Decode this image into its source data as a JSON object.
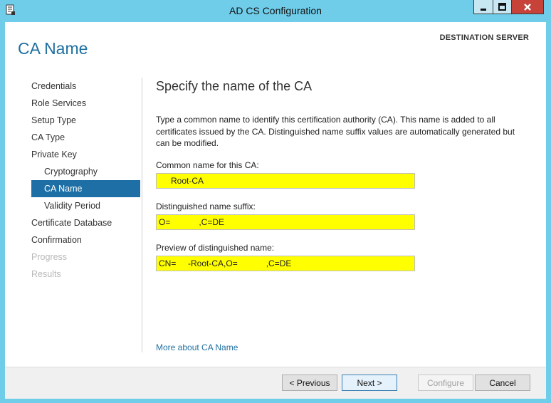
{
  "window": {
    "title": "AD CS Configuration",
    "controls": {
      "minimize": "_",
      "maximize": "□",
      "close": "×"
    }
  },
  "page": {
    "title": "CA Name",
    "destination_label": "DESTINATION SERVER"
  },
  "nav": {
    "items": [
      {
        "label": "Credentials",
        "state": "normal",
        "level": 0
      },
      {
        "label": "Role Services",
        "state": "normal",
        "level": 0
      },
      {
        "label": "Setup Type",
        "state": "normal",
        "level": 0
      },
      {
        "label": "CA Type",
        "state": "normal",
        "level": 0
      },
      {
        "label": "Private Key",
        "state": "normal",
        "level": 0
      },
      {
        "label": "Cryptography",
        "state": "normal",
        "level": 1
      },
      {
        "label": "CA Name",
        "state": "active",
        "level": 1
      },
      {
        "label": "Validity Period",
        "state": "normal",
        "level": 1
      },
      {
        "label": "Certificate Database",
        "state": "normal",
        "level": 0
      },
      {
        "label": "Confirmation",
        "state": "normal",
        "level": 0
      },
      {
        "label": "Progress",
        "state": "disabled",
        "level": 0
      },
      {
        "label": "Results",
        "state": "disabled",
        "level": 0
      }
    ]
  },
  "main": {
    "heading": "Specify the name of the CA",
    "description": "Type a common name to identify this certification authority (CA). This name is added to all certificates issued by the CA. Distinguished name suffix values are automatically generated but can be modified.",
    "common_name_label": "Common name for this CA:",
    "common_name_value": "Root-CA",
    "suffix_label": "Distinguished name suffix:",
    "suffix_value": "O=            ,C=DE",
    "preview_label": "Preview of distinguished name:",
    "preview_value": "CN=     -Root-CA,O=            ,C=DE",
    "more_link": "More about CA Name",
    "highlight_color": "#ffff00"
  },
  "footer": {
    "previous": "< Previous",
    "next": "Next >",
    "configure": "Configure",
    "cancel": "Cancel"
  },
  "colors": {
    "title_bar": "#6fcdea",
    "accent": "#1e6fa6",
    "close_button": "#c7433a"
  }
}
